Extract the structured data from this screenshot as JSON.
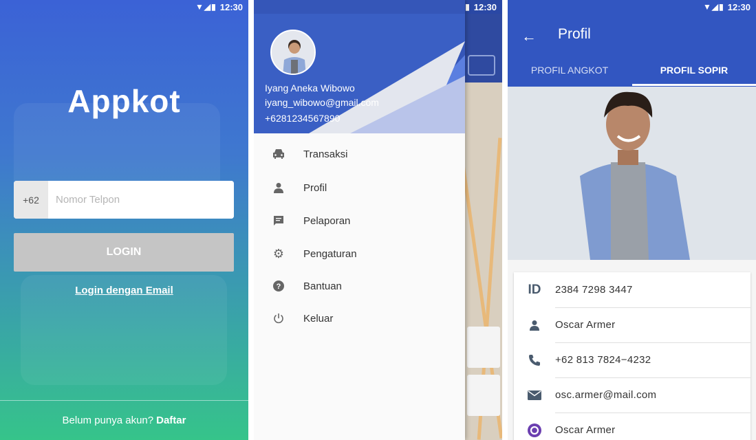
{
  "status_bar": {
    "time": "12:30"
  },
  "login": {
    "app_name": "Appkot",
    "country_code": "+62",
    "phone_placeholder": "Nomor Telpon",
    "login_button": "LOGIN",
    "email_login_link": "Login dengan Email",
    "signup_prompt": "Belum punya akun?",
    "signup_link": "Daftar"
  },
  "drawer": {
    "user": {
      "name": "Iyang Aneka Wibowo",
      "email": "iyang_wibowo@gmail.com",
      "phone": "+6281234567890"
    },
    "menu": [
      {
        "label": "Transaksi",
        "icon": "car-icon"
      },
      {
        "label": "Profil",
        "icon": "person-icon"
      },
      {
        "label": "Pelaporan",
        "icon": "message-icon"
      },
      {
        "label": "Pengaturan",
        "icon": "gear-icon"
      },
      {
        "label": "Bantuan",
        "icon": "help-icon"
      },
      {
        "label": "Keluar",
        "icon": "power-icon"
      }
    ]
  },
  "profile": {
    "title": "Profil",
    "tabs": [
      {
        "label": "PROFIL ANGKOT",
        "active": false
      },
      {
        "label": "PROFIL SOPIR",
        "active": true
      }
    ],
    "details": [
      {
        "icon": "id-icon",
        "icon_text": "ID",
        "value": "2384 7298 3447"
      },
      {
        "icon": "person-icon",
        "value": "Oscar Armer"
      },
      {
        "icon": "phone-icon",
        "value": "+62 813 7824−4232"
      },
      {
        "icon": "email-icon",
        "value": "osc.armer@mail.com"
      },
      {
        "icon": "viber-icon",
        "value": "Oscar Armer"
      }
    ]
  },
  "colors": {
    "primary": "#3256c1",
    "login_gradient_top": "#3b62d6",
    "login_gradient_bottom": "#36c48a",
    "button_disabled": "#c5c5c5"
  }
}
